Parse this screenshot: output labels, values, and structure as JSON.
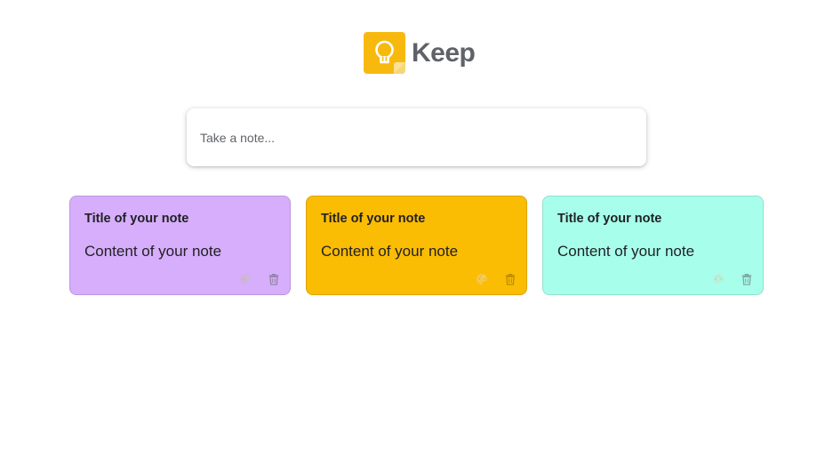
{
  "app": {
    "name": "Keep",
    "brand_color": "#f8b90f"
  },
  "composer": {
    "placeholder": "Take a note..."
  },
  "notes": [
    {
      "title": "Title of your note",
      "content": "Content of your note",
      "color": "#d7aefb",
      "actions": [
        "palette-icon",
        "trash-icon"
      ]
    },
    {
      "title": "Title of your note",
      "content": "Content of your note",
      "color": "#fbbc04",
      "actions": [
        "palette-icon",
        "trash-icon"
      ]
    },
    {
      "title": "Title of your note",
      "content": "Content of your note",
      "color": "#a7ffeb",
      "actions": [
        "palette-icon",
        "trash-icon"
      ]
    }
  ]
}
